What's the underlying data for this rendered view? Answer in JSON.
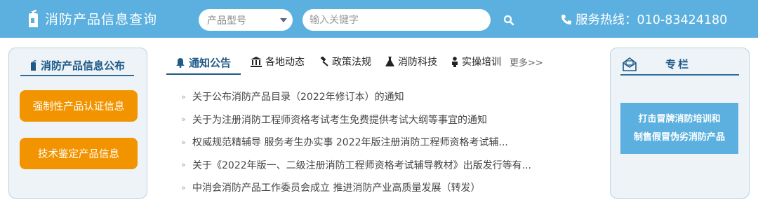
{
  "header": {
    "site_title": "消防产品信息查询",
    "select_value": "产品型号",
    "search_placeholder": "输入关键字",
    "hotline": "服务热线：010-83424180"
  },
  "left": {
    "title": "消防产品信息公布",
    "buttons": [
      "强制性产品认证信息",
      "技术鉴定产品信息"
    ]
  },
  "tabs": {
    "items": [
      {
        "label": "通知公告",
        "icon": "bell-icon"
      },
      {
        "label": "各地动态",
        "icon": "building-icon"
      },
      {
        "label": "政策法规",
        "icon": "gavel-icon"
      },
      {
        "label": "消防科技",
        "icon": "flask-icon"
      },
      {
        "label": "实操培训",
        "icon": "user-icon"
      }
    ],
    "more": "更多>>"
  },
  "news": [
    "关于公布消防产品目录（2022年修订本）的通知",
    "关于为注册消防工程师资格考试考生免费提供考试大纲等事宜的通知",
    "权威规范精辅导 服务考生办实事 2022年版注册消防工程师资格考试辅...",
    "关于《2022年版一、二级注册消防工程师资格考试辅导教材》出版发行等有...",
    "中消会消防产品工作委员会成立 推进消防产业高质量发展（转发）"
  ],
  "right": {
    "title": "专栏",
    "banner_line1": "打击冒牌消防培训和",
    "banner_line2": "制售假冒伪劣消防产品"
  },
  "colors": {
    "header_bg": "#5bb0df",
    "accent_orange": "#f29400",
    "title_blue": "#1d5a88",
    "panel_bg": "#eef3f7"
  }
}
